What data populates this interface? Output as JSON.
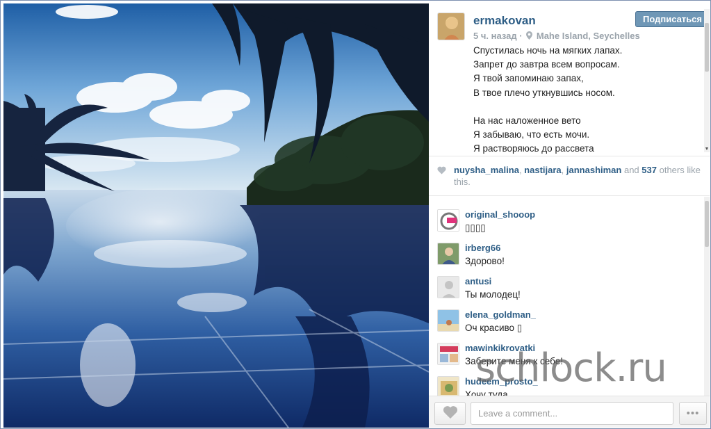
{
  "post": {
    "owner": "ermakovan",
    "follow_label": "Подписаться",
    "time": "5 ч. назад",
    "separator": "·",
    "location": "Mahe Island, Seychelles",
    "caption_lines": [
      "Спустилась ночь на мягких лапах.",
      "Запрет до завтра всем вопросам.",
      "Я твой запоминаю запах,",
      "В твое плечо уткнувшись носом.",
      "",
      "На нас наложенное вето",
      "Я забываю, что есть мочи.",
      "Я растворяюсь до рассвета"
    ]
  },
  "likes": {
    "users": [
      "nuysha_malina",
      "nastijara",
      "jannashiman"
    ],
    "sep1": ", ",
    "sep2": ", ",
    "and_text": " and ",
    "count": "537",
    "suffix": " others like this."
  },
  "comments": [
    {
      "user": "original_shooop",
      "text": "▯▯▯▯"
    },
    {
      "user": "irberg66",
      "text": "Здорово!"
    },
    {
      "user": "antusi",
      "text": "Ты молодец!"
    },
    {
      "user": "elena_goldman_",
      "text": "Оч красиво ▯"
    },
    {
      "user": "mawinkikrovatki",
      "text": "Заберите меня к себе!"
    },
    {
      "user": "hudeem_prosto_",
      "text": "Хочу туда"
    }
  ],
  "composer": {
    "placeholder": "Leave a comment...",
    "more_label": "•••"
  },
  "watermark": "schlock.ru",
  "colors": {
    "username": "#2e5e86",
    "follow_button": "#6f97b6",
    "meta_gray": "#9aa3ab",
    "frame_border": "#7c8fb0"
  },
  "icons": {
    "location": "map-pin-icon",
    "like": "heart-icon",
    "more": "ellipsis-icon"
  }
}
